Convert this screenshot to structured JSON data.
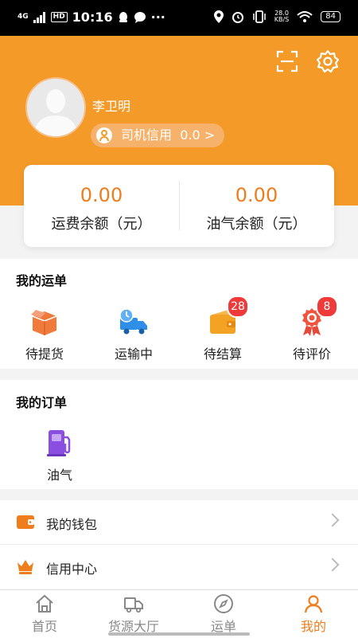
{
  "status_bar": {
    "network": "4G",
    "hd": "HD",
    "time": "10:16",
    "more": "···",
    "speed_value": "28.0",
    "speed_unit": "KB/S",
    "battery": "84"
  },
  "profile": {
    "name": "李卫明",
    "credit_label": "司机信用",
    "credit_value": "0.0 >"
  },
  "balance": {
    "freight_amount": "0.00",
    "freight_label": "运费余额（元）",
    "fuel_amount": "0.00",
    "fuel_label": "油气余额（元）"
  },
  "waybills": {
    "title": "我的运单",
    "items": [
      {
        "label": "待提货",
        "icon": "box-icon"
      },
      {
        "label": "运输中",
        "icon": "truck-clock-icon"
      },
      {
        "label": "待结算",
        "icon": "wallet-icon",
        "badge": "28"
      },
      {
        "label": "待评价",
        "icon": "award-icon",
        "badge": "8"
      }
    ]
  },
  "orders": {
    "title": "我的订单",
    "items": [
      {
        "label": "油气",
        "icon": "fuel-pump-icon"
      }
    ]
  },
  "menu": [
    {
      "label": "我的钱包",
      "icon": "wallet-icon"
    },
    {
      "label": "信用中心",
      "icon": "crown-icon"
    }
  ],
  "nav": [
    {
      "label": "首页",
      "icon": "home-icon"
    },
    {
      "label": "货源大厅",
      "icon": "truck-icon"
    },
    {
      "label": "运单",
      "icon": "compass-icon"
    },
    {
      "label": "我的",
      "icon": "user-icon",
      "active": true
    }
  ],
  "colors": {
    "brand_orange": "#f39a28",
    "accent_orange": "#ef7d1b",
    "badge_red": "#ef3a3a"
  }
}
